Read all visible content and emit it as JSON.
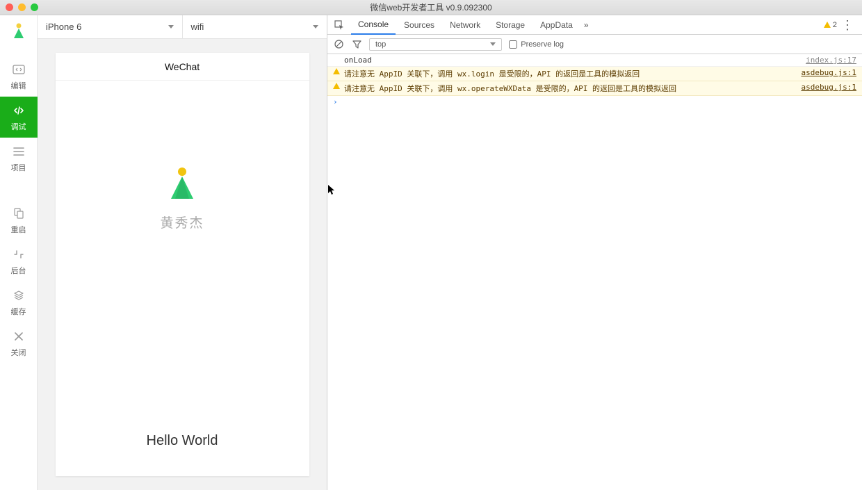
{
  "window": {
    "title": "微信web开发者工具 v0.9.092300"
  },
  "sidebar": {
    "items": [
      {
        "label": "编辑"
      },
      {
        "label": "调试"
      },
      {
        "label": "项目"
      },
      {
        "label": "重启"
      },
      {
        "label": "后台"
      },
      {
        "label": "缓存"
      },
      {
        "label": "关闭"
      }
    ]
  },
  "preview": {
    "device": "iPhone 6",
    "network": "wifi",
    "navbar_title": "WeChat",
    "username": "黄秀杰",
    "hello": "Hello World"
  },
  "devtools": {
    "tabs": [
      "Console",
      "Sources",
      "Network",
      "Storage",
      "AppData"
    ],
    "more_glyph": "»",
    "warning_count": "2",
    "context": "top",
    "preserve_label": "Preserve log",
    "lines": [
      {
        "type": "log",
        "msg": "onLoad",
        "src": "index.js:17"
      },
      {
        "type": "warn",
        "msg": "请注意无 AppID 关联下，调用 wx.login 是受限的，API 的返回是工具的模拟返回",
        "src": "asdebug.js:1"
      },
      {
        "type": "warn",
        "msg": "请注意无 AppID 关联下，调用 wx.operateWXData 是受限的，API 的返回是工具的模拟返回",
        "src": "asdebug.js:1"
      }
    ],
    "prompt_glyph": "›"
  }
}
